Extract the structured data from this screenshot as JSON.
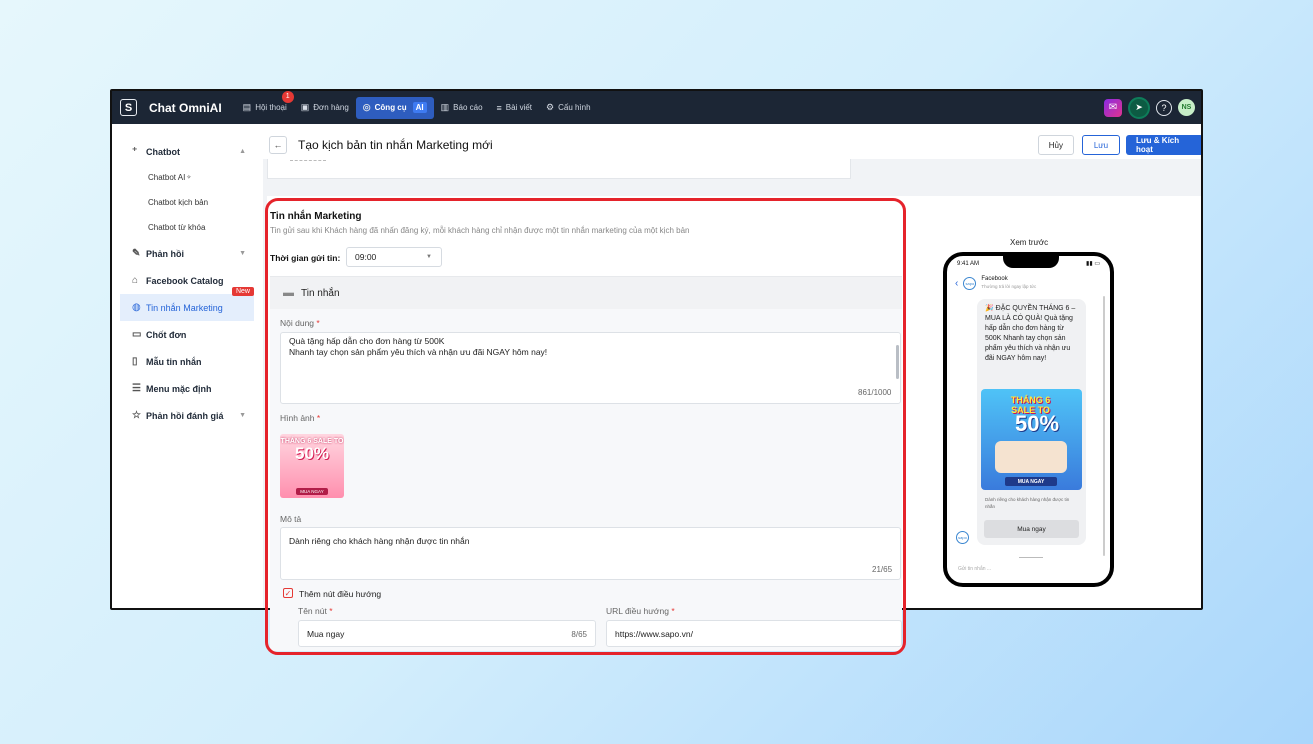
{
  "topbar": {
    "brand_letter": "S",
    "app_name": "Chat OmniAI",
    "nav": [
      {
        "label": "Hội thoại",
        "icon": "chat-icon"
      },
      {
        "label": "Đơn hàng",
        "icon": "order-icon"
      },
      {
        "label": "Công cụ",
        "icon": "tools-icon",
        "active": true
      },
      {
        "label": "Báo cáo",
        "icon": "report-icon"
      },
      {
        "label": "Bài viết",
        "icon": "post-icon"
      },
      {
        "label": "Cấu hình",
        "icon": "settings-icon"
      }
    ],
    "chat_badge": "1",
    "ai_label": "AI",
    "avatar": "NS"
  },
  "sidebar": {
    "chatbot": "Chatbot",
    "sub": [
      "Chatbot AI",
      "Chatbot kịch bản",
      "Chatbot từ khóa"
    ],
    "items": [
      "Phản hồi",
      "Facebook Catalog",
      "Tin nhắn Marketing",
      "Chốt đơn",
      "Mẫu tin nhắn",
      "Menu mặc định",
      "Phản hồi đánh giá"
    ],
    "new_tag": "New"
  },
  "header": {
    "title": "Tạo kịch bản tin nhắn Marketing mới",
    "cancel": "Hủy",
    "save": "Lưu",
    "save_activate": "Lưu & Kích hoạt"
  },
  "form": {
    "title": "Tin nhắn Marketing",
    "subtitle": "Tin gửi sau khi Khách hàng đã nhấn đăng ký, mỗi khách hàng chỉ nhận được một tin nhắn marketing của một kịch bản",
    "time_label": "Thời gian gửi tin:",
    "time_value": "09:00",
    "section_title": "Tin nhắn",
    "content_label": "Nội dung",
    "content_lines": [
      "Quà tặng hấp dẫn cho đơn hàng từ 500K",
      "Nhanh tay chọn sản phẩm yêu thích và nhận ưu đãi NGAY hôm nay!"
    ],
    "content_counter": "861/1000",
    "image_label": "Hình ảnh",
    "promo_title": "THÁNG 6 SALE TO",
    "promo_value": "50%",
    "promo_button": "MUA NGAY",
    "desc_label": "Mô tả",
    "desc_value": "Dành riêng cho khách hàng nhận được tin nhắn",
    "desc_counter": "21/65",
    "nav_checkbox_label": "Thêm nút điều hướng",
    "button_name_label": "Tên nút",
    "button_name_value": "Mua ngay",
    "button_name_counter": "8/65",
    "url_label": "URL điều hướng",
    "url_value": "https://www.sapo.vn/"
  },
  "preview": {
    "title": "Xem trước",
    "time": "9:41 AM",
    "page_name": "Facebook",
    "page_sub": "Thường trả lời ngay lập tức",
    "logo_text": "sapo",
    "message": "🎉 ĐẶC QUYỀN THÁNG 6 – MUA LÀ CÓ QUÀ! Quà tặng hấp dẫn cho đơn hàng từ 500K Nhanh tay chọn sản phẩm yêu thích và nhận ưu đãi NGAY hôm nay!",
    "img_title": "THÁNG 6 SALE TO",
    "img_value": "50%",
    "img_button": "MUA NGAY",
    "caption": "Dành riêng cho khách hàng nhận được tin nhắn",
    "button": "Mua ngay",
    "input_placeholder": "Gửi tin nhắn ..."
  }
}
